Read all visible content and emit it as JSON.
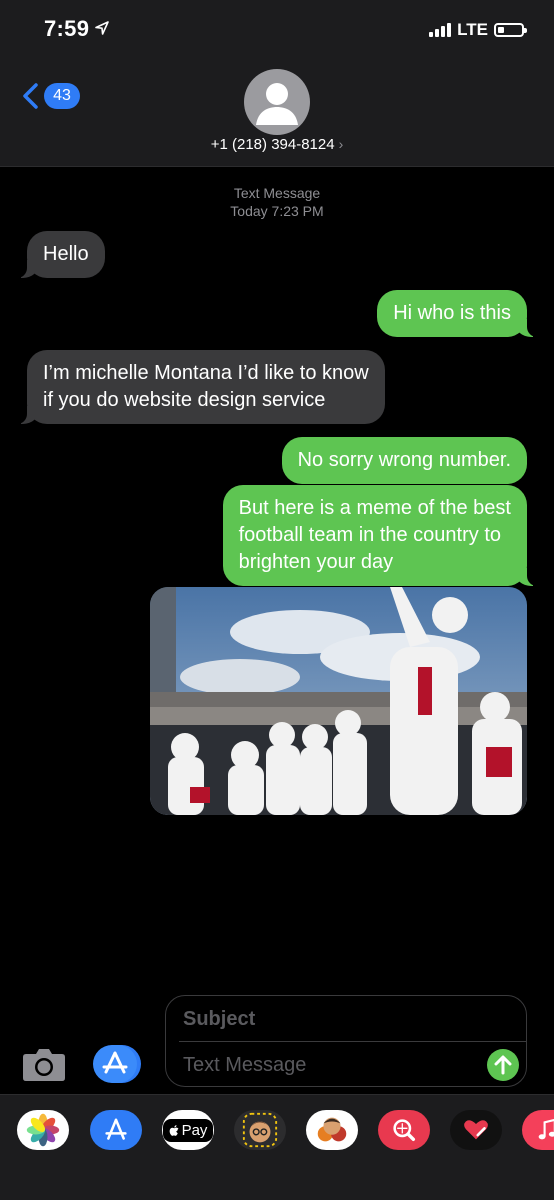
{
  "status": {
    "time": "7:59",
    "network": "LTE",
    "battery_level": 0.25
  },
  "header": {
    "back_count": "43",
    "contact_number": "+1 (218) 394-8124",
    "contact_chevron": "›"
  },
  "thread": {
    "service": "Text Message",
    "timestamp": "Today 7:23 PM",
    "messages": [
      {
        "from": "them",
        "text": "Hello"
      },
      {
        "from": "me",
        "text": "Hi who is this"
      },
      {
        "from": "them",
        "lines": [
          "I’m michelle Montana I’d like to know",
          "if you do website design service"
        ]
      },
      {
        "from": "me",
        "text": "No sorry wrong number."
      },
      {
        "from": "me",
        "lines": [
          "But here is a meme of the best",
          "football team in the country to",
          "brighten your day"
        ]
      },
      {
        "from": "me",
        "image": "football-team-huddle-photo"
      }
    ]
  },
  "composer": {
    "subject_placeholder": "Subject",
    "message_placeholder": "Text Message"
  },
  "app_strip": {
    "apps": [
      "photos-app-icon",
      "app-store-icon",
      "apple-pay-icon",
      "memoji-icon",
      "memoji-stickers-icon",
      "web-search-icon",
      "digital-touch-icon",
      "music-icon"
    ],
    "apple_pay_label": "Pay"
  },
  "colors": {
    "incoming_bubble": "#3a3a3c",
    "outgoing_bubble": "#5ec552",
    "accent": "#2f7cf6"
  }
}
